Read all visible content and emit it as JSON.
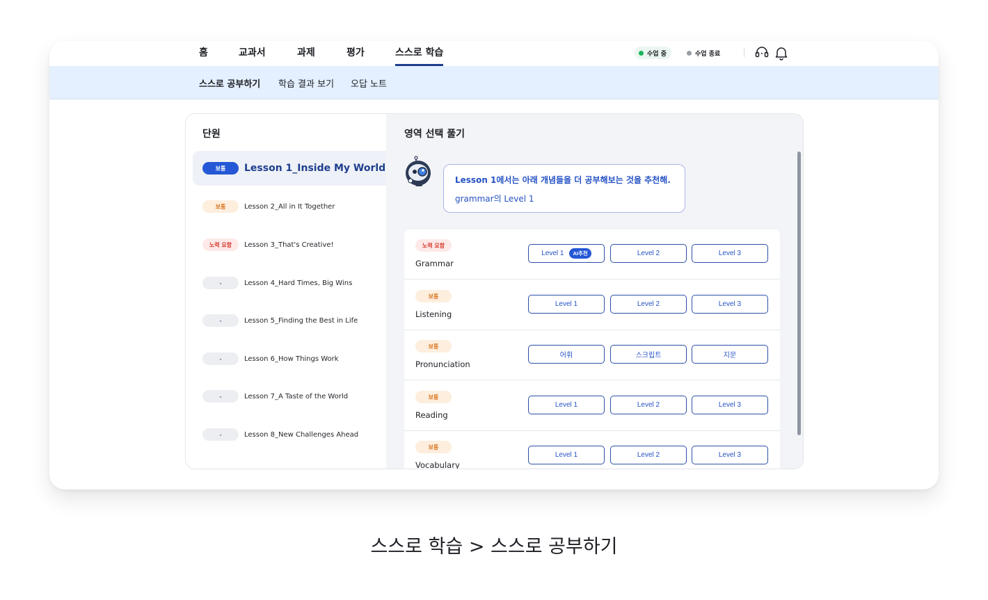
{
  "topnav": {
    "items": [
      "홈",
      "교과서",
      "과제",
      "평가",
      "스스로 학습"
    ],
    "status_live": "수업 중",
    "status_end": "수업 종료"
  },
  "subnav": {
    "items": [
      "스스로 공부하기",
      "학습 결과 보기",
      "오답 노트"
    ]
  },
  "left": {
    "title": "단원",
    "lessons": [
      {
        "badge": "보통",
        "label": "Lesson 1_Inside My World"
      },
      {
        "badge": "보통",
        "label": "Lesson 2_All in It Together"
      },
      {
        "badge": "노력 요함",
        "label": "Lesson 3_That's Creative!"
      },
      {
        "badge": "-",
        "label": "Lesson 4_Hard Times, Big Wins"
      },
      {
        "badge": "-",
        "label": "Lesson 5_Finding the Best in Life"
      },
      {
        "badge": "-",
        "label": "Lesson 6_How Things Work"
      },
      {
        "badge": "-",
        "label": "Lesson 7_A Taste of the World"
      },
      {
        "badge": "-",
        "label": "Lesson 8_New Challenges Ahead"
      }
    ]
  },
  "right": {
    "title": "영역 선택 풀기",
    "bubble_line1": "Lesson 1에서는 아래 개념들을 더 공부해보는 것을 추천해.",
    "bubble_line2": "grammar의 Level 1",
    "ai_chip": "AI추천",
    "areas": [
      {
        "badge": "노력 요함",
        "name": "Grammar",
        "buttons": [
          "Level 1",
          "Level 2",
          "Level 3"
        ]
      },
      {
        "badge": "보통",
        "name": "Listening",
        "buttons": [
          "Level 1",
          "Level 2",
          "Level 3"
        ]
      },
      {
        "badge": "보통",
        "name": "Pronunciation",
        "buttons": [
          "어휘",
          "스크립트",
          "지문"
        ]
      },
      {
        "badge": "보통",
        "name": "Reading",
        "buttons": [
          "Level 1",
          "Level 2",
          "Level 3"
        ]
      },
      {
        "badge": "보통",
        "name": "Vocabulary",
        "buttons": [
          "Level 1",
          "Level 2",
          "Level 3"
        ]
      }
    ]
  },
  "caption": "스스로 학습 > 스스로 공부하기",
  "colors": {
    "primary": "#2458d6",
    "nav_underline": "#1e3e8e",
    "subnav_bg": "#e4efff",
    "badge_normal": "#d9741e",
    "badge_effort": "#d63a2f"
  },
  "icons": [
    "headset-icon",
    "bell-icon",
    "robot-icon"
  ]
}
